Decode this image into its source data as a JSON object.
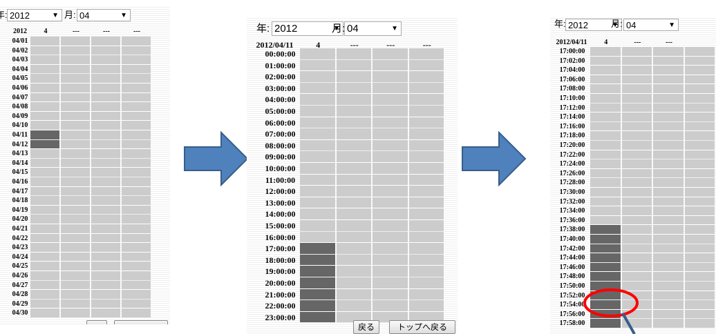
{
  "panel1": {
    "year_label": "年:",
    "year_value": "2012",
    "month_label": "月:",
    "month_value": "04",
    "header": [
      "2012",
      "4",
      "---",
      "---",
      "---"
    ],
    "rows": [
      "04/01",
      "04/02",
      "04/03",
      "04/04",
      "04/05",
      "04/06",
      "04/07",
      "04/08",
      "04/09",
      "04/10",
      "04/11",
      "04/12",
      "04/13",
      "04/14",
      "04/15",
      "04/16",
      "04/17",
      "04/18",
      "04/19",
      "04/20",
      "04/21",
      "04/22",
      "04/23",
      "04/24",
      "04/25",
      "04/26",
      "04/27",
      "04/28",
      "04/29",
      "04/30"
    ],
    "highlighted": [
      "04/11",
      "04/12"
    ]
  },
  "panel2": {
    "year_label": "年:",
    "year_value": "2012",
    "month_label": "月:",
    "month_value": "04",
    "header": [
      "2012/04/11",
      "4",
      "---",
      "---",
      "---"
    ],
    "rows": [
      "00:00:00",
      "01:00:00",
      "02:00:00",
      "03:00:00",
      "04:00:00",
      "05:00:00",
      "06:00:00",
      "07:00:00",
      "08:00:00",
      "09:00:00",
      "10:00:00",
      "11:00:00",
      "12:00:00",
      "13:00:00",
      "14:00:00",
      "15:00:00",
      "16:00:00",
      "17:00:00",
      "18:00:00",
      "19:00:00",
      "20:00:00",
      "21:00:00",
      "22:00:00",
      "23:00:00"
    ],
    "highlighted": [
      "17:00:00",
      "18:00:00",
      "19:00:00",
      "20:00:00",
      "21:00:00",
      "22:00:00",
      "23:00:00"
    ],
    "back_button": "戻る",
    "top_button": "トップへ戻る"
  },
  "panel3": {
    "year_label": "年:",
    "year_value": "2012",
    "month_label": "月:",
    "month_value": "04",
    "header": [
      "2012/04/11",
      "4",
      "---",
      "---"
    ],
    "rows": [
      "17:00:00",
      "17:02:00",
      "17:04:00",
      "17:06:00",
      "17:08:00",
      "17:10:00",
      "17:12:00",
      "17:14:00",
      "17:16:00",
      "17:18:00",
      "17:20:00",
      "17:22:00",
      "17:24:00",
      "17:26:00",
      "17:28:00",
      "17:30:00",
      "17:32:00",
      "17:34:00",
      "17:36:00",
      "17:38:00",
      "17:40:00",
      "17:42:00",
      "17:44:00",
      "17:46:00",
      "17:48:00",
      "17:50:00",
      "17:52:00",
      "17:54:00",
      "17:56:00",
      "17:58:00"
    ],
    "highlighted": [
      "17:38:00",
      "17:40:00",
      "17:42:00",
      "17:44:00",
      "17:46:00",
      "17:48:00",
      "17:50:00",
      "17:52:00",
      "17:54:00",
      "17:56:00",
      "17:58:00"
    ]
  },
  "colors": {
    "cell": "#cccccc",
    "cell_highlight": "#666666",
    "arrow_fill": "#4f81bd",
    "arrow_stroke": "#385d8a",
    "circle": "#ff0000"
  }
}
